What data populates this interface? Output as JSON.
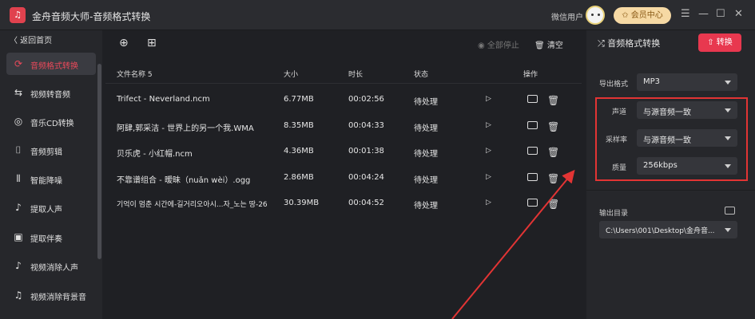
{
  "app": {
    "logo_text": "♫",
    "title": "金舟音频大师-音频格式转换"
  },
  "header": {
    "wechat_user": "微信用户",
    "vip_label": "✩ 会员中心",
    "menu": "☰",
    "minimize": "—",
    "maximize": "☐",
    "close": "✕"
  },
  "sidebar": {
    "back": "〈 返回首页",
    "items": [
      {
        "label": "音频格式转换",
        "icon": "audio-convert-icon",
        "glyph": "⟳"
      },
      {
        "label": "视频转音频",
        "icon": "video-to-audio-icon",
        "glyph": "⇆"
      },
      {
        "label": "音乐CD转换",
        "icon": "cd-icon",
        "glyph": "◎"
      },
      {
        "label": "音频剪辑",
        "icon": "audio-cut-icon",
        "glyph": "⌷"
      },
      {
        "label": "智能降噪",
        "icon": "noise-reduce-icon",
        "glyph": "⫴"
      },
      {
        "label": "提取人声",
        "icon": "extract-vocal-icon",
        "glyph": "♪"
      },
      {
        "label": "提取伴奏",
        "icon": "extract-accompaniment-icon",
        "glyph": "▣"
      },
      {
        "label": "视频消除人声",
        "icon": "video-remove-vocal-icon",
        "glyph": "♪"
      },
      {
        "label": "视频消除背景音",
        "icon": "video-remove-bgm-icon",
        "glyph": "♫"
      }
    ]
  },
  "toolbar": {
    "add_file_glyph": "⊕",
    "add_folder_glyph": "⊞",
    "stop_all": "◉ 全部停止",
    "clear": "🗑 清空"
  },
  "table": {
    "headers": {
      "name": "文件名称 5",
      "size": "大小",
      "duration": "时长",
      "status": "状态",
      "action": "操作"
    },
    "rows": [
      {
        "name": "Trifect - Neverland.ncm",
        "size": "6.77MB",
        "duration": "00:02:56",
        "status": "待处理"
      },
      {
        "name": "阿肆,郭采洁 - 世界上的另一个我.WMA",
        "size": "8.35MB",
        "duration": "00:04:33",
        "status": "待处理"
      },
      {
        "name": "贝乐虎 - 小红帽.ncm",
        "size": "4.36MB",
        "duration": "00:01:38",
        "status": "待处理"
      },
      {
        "name": "不靠谱组合 - 暧昧（nuǎn wèi）.ogg",
        "size": "2.86MB",
        "duration": "00:04:24",
        "status": "待处理"
      },
      {
        "name": "기억이 멈춘 시간에-길거리오아시...자_노는 땅-26",
        "size": "30.39MB",
        "duration": "00:04:52",
        "status": "待处理"
      }
    ],
    "play_glyph": "▷",
    "trash_glyph": "🗑"
  },
  "right": {
    "title": "⤮ 音频格式转换",
    "convert": "⇧ 转换",
    "export_format_label": "导出格式",
    "export_format": "MP3",
    "channel_label": "声道",
    "channel": "与源音频一致",
    "sample_rate_label": "采样率",
    "sample_rate": "与源音频一致",
    "quality_label": "质量",
    "quality": "256kbps",
    "output_dir_label": "输出目录",
    "output_dir": "C:\\Users\\001\\Desktop\\金舟音..."
  },
  "colors": {
    "accent": "#e8384f",
    "highlight_box": "#e23434",
    "background": "#1f2024",
    "panel": "#26272b"
  }
}
